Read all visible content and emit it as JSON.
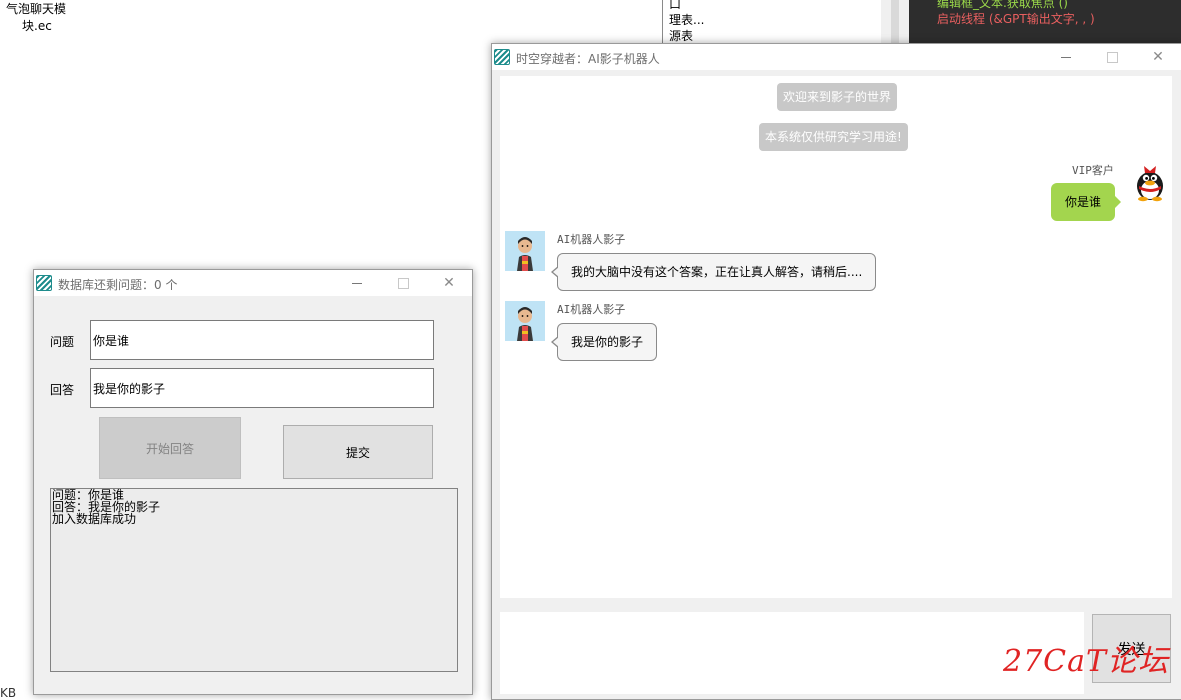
{
  "background": {
    "desktop_items": [
      "气泡聊天模",
      "块.ec"
    ],
    "bottom_fragment": "KB",
    "mid_list": [
      "口",
      "理表...",
      "源表"
    ],
    "code_lines": [
      {
        "text": "编辑框_文本.获取焦点 ()",
        "color": "#9ad84a"
      },
      {
        "text": "启动线程 (&GPT输出文字, , )",
        "color": "#e85f5f"
      }
    ]
  },
  "db_dialog": {
    "title": "数据库还剩问题：0 个",
    "question_label": "问题",
    "question_value": "你是谁",
    "answer_label": "回答",
    "answer_value": "我是你的影子",
    "start_button": "开始回答",
    "submit_button": "提交",
    "log_lines": [
      "问题：你是谁",
      "回答：我是你的影子",
      "加入数据库成功"
    ]
  },
  "chat_window": {
    "title": "时空穿越者：AI影子机器人",
    "system_messages": [
      "欢迎来到影子的世界",
      "本系统仅供研究学习用途!"
    ],
    "user_name": "VIP客户",
    "user_message": "你是谁",
    "bot_name": "AI机器人影子",
    "bot_messages": [
      "我的大脑中没有这个答案，正在让真人解答，请稍后....",
      "我是你的影子"
    ],
    "send_button": "发送"
  },
  "watermark": "27CaT论坛",
  "colors": {
    "user_bubble": "#a3d54e",
    "system_bubble": "#c8c8c8",
    "watermark": "#e02424",
    "app_icon": "#1e8c8c"
  }
}
